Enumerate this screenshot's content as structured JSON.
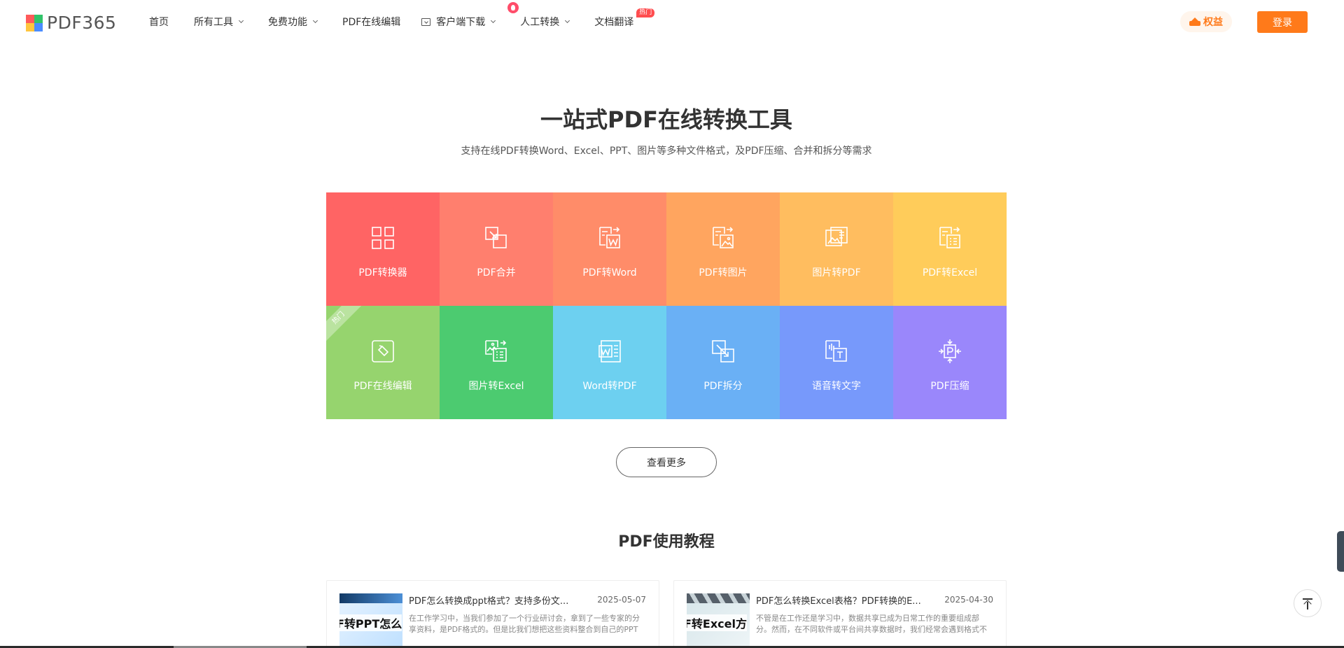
{
  "header": {
    "logo_text": "PDF365",
    "nav": [
      {
        "label": "首页"
      },
      {
        "label": "所有工具"
      },
      {
        "label": "免费功能"
      },
      {
        "label": "PDF在线编辑"
      },
      {
        "label": "客户端下载"
      },
      {
        "label": "人工转换"
      },
      {
        "label": "文档翻译",
        "badge": "热门"
      }
    ],
    "rights_label": "权益",
    "login_label": "登录"
  },
  "hero": {
    "title": "一站式PDF在线转换工具",
    "subtitle": "支持在线PDF转换Word、Excel、PPT、图片等多种文件格式，及PDF压缩、合并和拆分等需求"
  },
  "tools": [
    {
      "label": "PDF转换器",
      "icon": "grid-icon",
      "color": "#ff6464"
    },
    {
      "label": "PDF合并",
      "icon": "merge-icon",
      "color": "#ff7f6e"
    },
    {
      "label": "PDF转Word",
      "icon": "pdf-to-word-icon",
      "color": "#ff8c69"
    },
    {
      "label": "PDF转图片",
      "icon": "pdf-to-image-icon",
      "color": "#ffa55f"
    },
    {
      "label": "图片转PDF",
      "icon": "image-to-pdf-icon",
      "color": "#ffbd5f"
    },
    {
      "label": "PDF转Excel",
      "icon": "pdf-to-excel-icon",
      "color": "#ffcc5a"
    },
    {
      "label": "PDF在线编辑",
      "icon": "edit-icon",
      "color": "#96d46e",
      "ribbon": "热门"
    },
    {
      "label": "图片转Excel",
      "icon": "image-to-excel-icon",
      "color": "#4ccb70"
    },
    {
      "label": "Word转PDF",
      "icon": "word-to-pdf-icon",
      "color": "#6dd0f0"
    },
    {
      "label": "PDF拆分",
      "icon": "split-icon",
      "color": "#6ab0f5"
    },
    {
      "label": "语音转文字",
      "icon": "voice-to-text-icon",
      "color": "#7799fb"
    },
    {
      "label": "PDF压缩",
      "icon": "compress-icon",
      "color": "#9a87fb"
    }
  ],
  "more_label": "查看更多",
  "tutorial_title": "PDF使用教程",
  "articles": [
    {
      "thumb_text": "F转PPT怎么",
      "title": "PDF怎么转换成ppt格式？支持多份文...",
      "date": "2025-05-07",
      "desc": "在工作学习中，当我们参加了一个行业研讨会，拿到了一些专家的分享资料，是PDF格式的。但是比我们想把这些资料整合到自己的PPT里..."
    },
    {
      "thumb_text": "F转Excel方",
      "title": "PDF怎么转换Excel表格？PDF转换的E...",
      "date": "2025-04-30",
      "desc": "不管是在工作还是学习中，数据共享已成为日常工作的重要组成部分。然而，在不同软件或平台间共享数据时，我们经常会遇到格式不兼容..."
    }
  ]
}
